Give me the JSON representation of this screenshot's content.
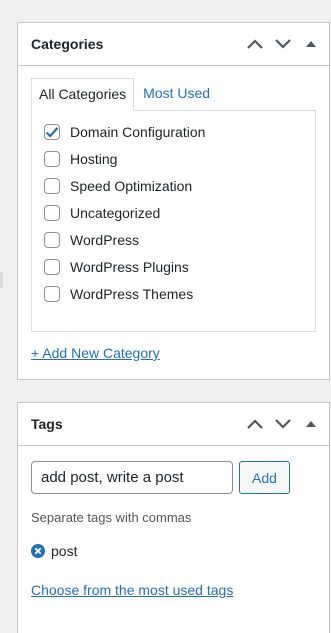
{
  "colors": {
    "link": "#2271b1",
    "checkmark": "#2271b1",
    "remove_tag": "#2271b1",
    "border": "#c3c4c7",
    "background": "#f0f0f1"
  },
  "categories_box": {
    "title": "Categories",
    "icons": [
      "chevron-up-icon",
      "chevron-down-icon",
      "caret-up-icon"
    ],
    "tabs": [
      {
        "label": "All Categories",
        "active": true
      },
      {
        "label": "Most Used",
        "active": false
      }
    ],
    "items": [
      {
        "label": "Domain Configuration",
        "checked": true
      },
      {
        "label": "Hosting",
        "checked": false
      },
      {
        "label": "Speed Optimization",
        "checked": false
      },
      {
        "label": "Uncategorized",
        "checked": false
      },
      {
        "label": "WordPress",
        "checked": false
      },
      {
        "label": "WordPress Plugins",
        "checked": false
      },
      {
        "label": "WordPress Themes",
        "checked": false
      }
    ],
    "add_new_link": "+ Add New Category"
  },
  "tags_box": {
    "title": "Tags",
    "icons": [
      "chevron-up-icon",
      "chevron-down-icon",
      "caret-up-icon"
    ],
    "input_value": "add post, write a post",
    "add_button": "Add",
    "help_text": "Separate tags with commas",
    "tags": [
      {
        "label": "post",
        "icon": "remove-circle-icon"
      }
    ],
    "most_used_link": "Choose from the most used tags"
  }
}
